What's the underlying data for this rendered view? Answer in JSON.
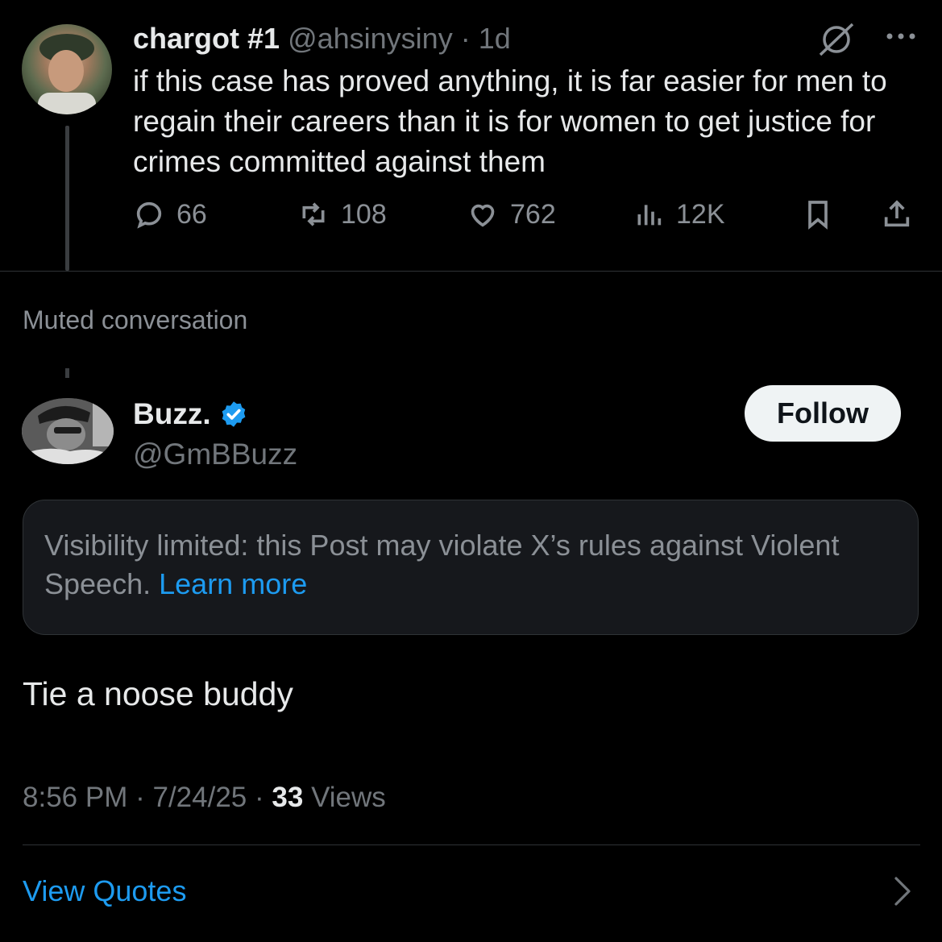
{
  "tweet1": {
    "display_name": "chargot #1",
    "handle": "@ahsinysiny",
    "time_sep": "·",
    "time": "1d",
    "text": "if this case has proved anything, it is far easier for men to regain their careers than it is for women to get justice for crimes committed against them",
    "stats": {
      "replies": "66",
      "reposts": "108",
      "likes": "762",
      "views": "12K"
    },
    "icons": [
      "muted-icon",
      "more-icon",
      "reply-icon",
      "repost-icon",
      "like-icon",
      "views-icon",
      "bookmark-icon",
      "share-icon"
    ]
  },
  "muted_label": "Muted conversation",
  "tweet2": {
    "display_name": "Buzz.",
    "handle": "@GmBBuzz",
    "follow_label": "Follow",
    "notice_text": "Visibility limited: this Post may violate X’s rules against Violent Speech.",
    "notice_link": "Learn more",
    "text": "Tie a noose buddy",
    "time": "8:56 PM",
    "sep1": "·",
    "date": "7/24/25",
    "sep2": "·",
    "views_count": "33",
    "views_label": "Views"
  },
  "view_quotes_label": "View Quotes",
  "colors": {
    "background": "#000000",
    "accent": "#1d9bf0",
    "muted_text": "#71767b",
    "primary_text": "#e7e9ea"
  }
}
